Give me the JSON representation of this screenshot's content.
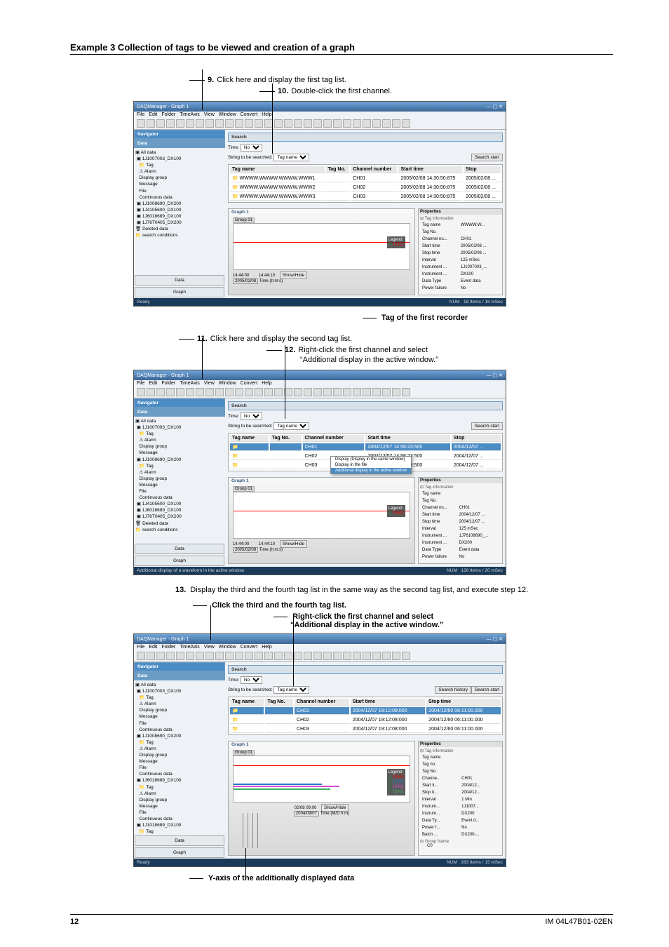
{
  "example_title": "Example 3  Collection of tags to be viewed and creation of a graph",
  "callout9": "Click here and display the first tag list.",
  "callout10": "Double-click the first channel.",
  "callout11": "Click here and display the second tag list.",
  "callout12_a": "Right-click the first channel and select",
  "callout12_b": "“Additional display in the active window.”",
  "tag_first_recorder": "Tag of the first recorder",
  "step13": "Display the third and the fourth tag list in the same way as the second tag list, and execute step 12.",
  "click34_title": "Click the third and the fourth tag list.",
  "rightclick_a": "Right-click the first channel and select",
  "rightclick_b": "“Additional display in the active window.”",
  "yaxis_label": "Y-axis of the additionally displayed data",
  "footer_page": "12",
  "footer_doc": "IM 04L47B01-02EN",
  "app": {
    "title": "DAQManager - Graph 1",
    "menu": [
      "File",
      "Edit",
      "Folder",
      "TimeAxis",
      "View",
      "Window",
      "Convert",
      "Help"
    ],
    "nav_header": "Navigator",
    "data_hdr": "Data",
    "tree": {
      "all": "All data",
      "r1": "1J1007003_DX100",
      "r2": "1J1008690_DX200",
      "r3": "1J4105600_DX100",
      "r4": "1J6018689_DX100",
      "r5": "1J76T0405_DX200",
      "r6": "1J1018689_DX100",
      "deleted": "Deleted data",
      "search": "search conditions",
      "tag": "Tag",
      "alarm": "Alarm",
      "display_group": "Display group",
      "message": "Message",
      "file": "File",
      "continuous": "Continuous data"
    },
    "btn_data": "Data",
    "btn_graph": "Graph"
  },
  "search": {
    "header": "Search",
    "time_label": "Time:",
    "time_value": "No",
    "string_label": "String to be searched:",
    "string_value": "Tag name",
    "btn": "Search start",
    "btn_hist": "Search history"
  },
  "taglist1": {
    "cols": [
      "Tag name",
      "Tag No.",
      "Channel number",
      "Start time",
      "Stop"
    ],
    "rows": [
      [
        "WWWW.WWWW.WWWW.WWW1",
        "",
        "CH01",
        "2005/02/08 14:30:50:875",
        "2005/02/08 ..."
      ],
      [
        "WWWW.WWWW.WWWW.WWW2",
        "",
        "CH02",
        "2005/02/08 14:30:50:875",
        "2005/02/08 ..."
      ],
      [
        "WWWW.WWWW.WWWW.WWW3",
        "",
        "CH03",
        "2005/02/08 14:30:50:875",
        "2005/02/08 ..."
      ]
    ]
  },
  "taglist2": {
    "rows": [
      [
        "",
        "",
        "CH01",
        "2004/12/07 14:56:23:500",
        "2004/12/07 ..."
      ],
      [
        "",
        "",
        "CH02",
        "2004/12/07 14:56:23:500",
        "2004/12/07 ..."
      ],
      [
        "",
        "",
        "CH03",
        "2004/12/07 14:56:23:500",
        "2004/12/07 ..."
      ]
    ]
  },
  "taglist3": {
    "cols": [
      "Tag name",
      "Tag No.",
      "Channel number",
      "Start time",
      "Stop time"
    ],
    "rows": [
      [
        "",
        "",
        "CH01",
        "2004/12/07 19:12:08:000",
        "2004/12/60 06:11:00.000"
      ],
      [
        "",
        "",
        "CH02",
        "2004/12/07 19:12:08:000",
        "2004/12/60 06:11:00.000"
      ],
      [
        "",
        "",
        "CH03",
        "2004/12/07 19:12:08:000",
        "2004/12/60 06:11:00.000"
      ]
    ]
  },
  "context_menu": [
    "Display (Display in the same window)",
    "Display in the file",
    "Additional display in the active window"
  ],
  "graph": {
    "title": "Graph 1",
    "group": "Group 01",
    "time1": "14:44:00",
    "time2": "14:44:10",
    "tlabel": "Time (h:m:s)",
    "date": "2005/02/08",
    "btn_show": "Show/Hide",
    "legend_hdr": "Legend",
    "legend1": "CH01"
  },
  "graph3": {
    "date": "02/08 09:00",
    "tlabel": "Time (M/D h:m)",
    "legend": [
      "CH01",
      "CH01",
      "CH01",
      "CH01"
    ]
  },
  "props1": {
    "header": "Properties",
    "section": "Tag information",
    "rows": [
      [
        "Tag name",
        "WWWW.W..."
      ],
      [
        "Tag No.",
        ""
      ],
      [
        "Channel nu...",
        "CH01"
      ],
      [
        "Start time",
        "2005/02/08 ..."
      ],
      [
        "Stop time",
        "2005/02/08 ..."
      ],
      [
        "Interval",
        "125 mSec"
      ],
      [
        "Instrument ...",
        "1J1007003_..."
      ],
      [
        "Instrument ...",
        "DX100"
      ],
      [
        "Data Type",
        "Event data"
      ],
      [
        "Power failure",
        "No"
      ]
    ]
  },
  "props2": {
    "rows": [
      [
        "Tag name",
        ""
      ],
      [
        "Tag No.",
        ""
      ],
      [
        "Channel nu...",
        "CH01"
      ],
      [
        "Start time",
        "2004/12/07 ..."
      ],
      [
        "Stop time",
        "2004/12/07 ..."
      ],
      [
        "Interval",
        "125 mSec"
      ],
      [
        "Instrument ...",
        "1J76108690_..."
      ],
      [
        "Instrument ...",
        "DX200"
      ],
      [
        "Data Type",
        "Event data"
      ],
      [
        "Power failure",
        "No"
      ]
    ]
  },
  "props3": {
    "rows": [
      [
        "Tag name",
        ""
      ],
      [
        "Tag no.",
        ""
      ],
      [
        "Tag No.",
        ""
      ],
      [
        "Channe...",
        "CH01"
      ],
      [
        "Start ti...",
        "2004/12..."
      ],
      [
        "Stop ti...",
        "2004/12..."
      ],
      [
        "Interval",
        "1 Min"
      ],
      [
        "Instrum...",
        "1J1007..."
      ],
      [
        "Instrum...",
        "DX200"
      ],
      [
        "Data Ty...",
        "Event d..."
      ],
      [
        "Power f...",
        "No"
      ],
      [
        "Batch ...",
        "DX200-..."
      ]
    ],
    "group_name": "Group Name",
    "c0": "C0"
  },
  "status": {
    "ready": "Ready",
    "num": "NUM",
    "items": "18 Items / 18 mSec",
    "items2": "126 Items / 20 mSec",
    "items3": "283 Items / 15 mSec",
    "additional": "Additional display of a waveform in the active window"
  }
}
